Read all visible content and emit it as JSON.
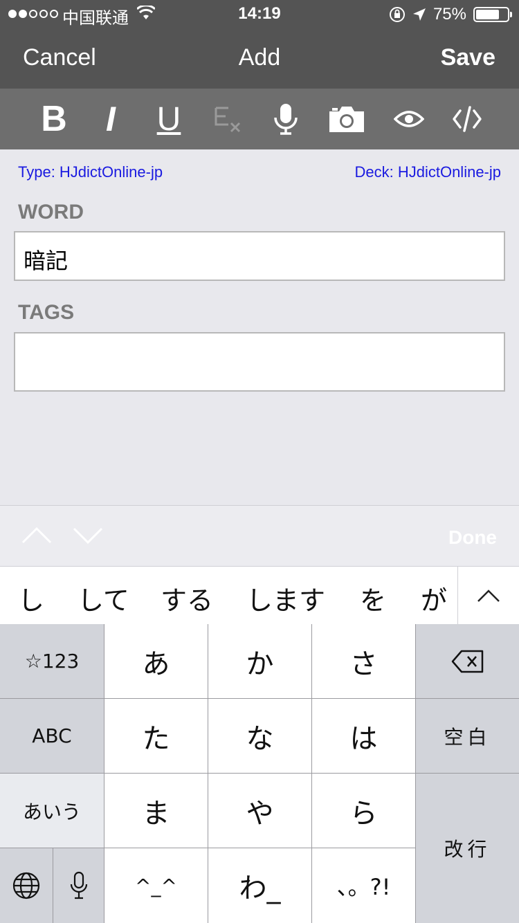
{
  "status_bar": {
    "carrier": "中国联通",
    "time": "14:19",
    "battery_percent_label": "75%",
    "battery_level": 0.75,
    "signal_bars_filled": 2,
    "signal_bars_total": 5
  },
  "nav": {
    "cancel_label": "Cancel",
    "title": "Add",
    "save_label": "Save"
  },
  "toolbar": {
    "bold_label": "B",
    "italic_label": "I",
    "underline_label": "U",
    "icons": [
      "bold-icon",
      "italic-icon",
      "underline-icon",
      "clear-format-icon",
      "microphone-icon",
      "camera-icon",
      "eye-icon",
      "code-icon"
    ]
  },
  "note": {
    "type_label": "Type: HJdictOnline-jp",
    "deck_label": "Deck: HJdictOnline-jp",
    "fields": [
      {
        "label": "WORD",
        "value": "暗記"
      },
      {
        "label": "TAGS",
        "value": ""
      }
    ]
  },
  "accessory_bar": {
    "done_label": "Done"
  },
  "candidates": [
    "し",
    "して",
    "する",
    "します",
    "を",
    "が"
  ],
  "keyboard": {
    "rows": [
      [
        "☆123",
        "あ",
        "か",
        "さ",
        ""
      ],
      [
        "ABC",
        "た",
        "な",
        "は",
        "空白"
      ],
      [
        "あいう",
        "ま",
        "や",
        "ら",
        "改行"
      ],
      [
        "",
        "",
        "^^",
        "わ",
        "、。?!"
      ]
    ],
    "key_123": "☆123",
    "key_a": "あ",
    "key_ka": "か",
    "key_sa": "さ",
    "key_abc": "ABC",
    "key_ta": "た",
    "key_na": "な",
    "key_ha": "は",
    "key_space": "空白",
    "key_aiu": "あいう",
    "key_ma": "ま",
    "key_ya": "や",
    "key_ra": "ら",
    "key_return": "改行",
    "key_emoticon": "^_^",
    "key_wa": "わ_",
    "key_punct": "、。?!"
  },
  "colors": {
    "nav_bg": "#545454",
    "toolbar_bg": "#6e6e6e",
    "link_blue": "#1a1ae0",
    "content_bg": "#e8e8ed"
  }
}
